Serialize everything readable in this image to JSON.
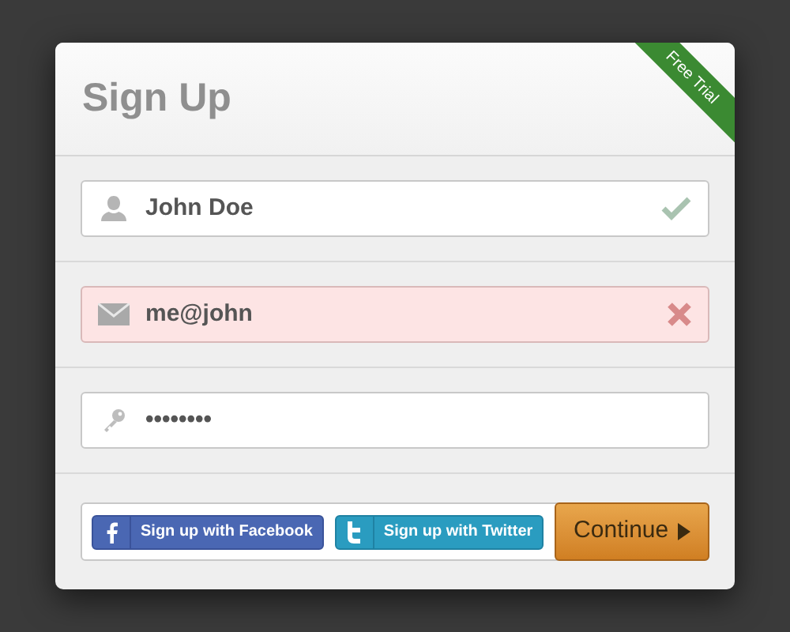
{
  "form": {
    "title": "Sign Up",
    "ribbon": "Free Trial"
  },
  "fields": [
    {
      "kind": "name",
      "value": "John Doe",
      "valid": true,
      "error": false
    },
    {
      "kind": "email",
      "value": "me@john",
      "valid": false,
      "error": true
    },
    {
      "kind": "password",
      "value": "••••••••",
      "valid": false,
      "error": false
    }
  ],
  "social": [
    {
      "kind": "facebook",
      "label": "Sign up with Facebook"
    },
    {
      "kind": "twitter",
      "label": "Sign up with Twitter"
    }
  ],
  "submit": {
    "label": "Continue"
  }
}
